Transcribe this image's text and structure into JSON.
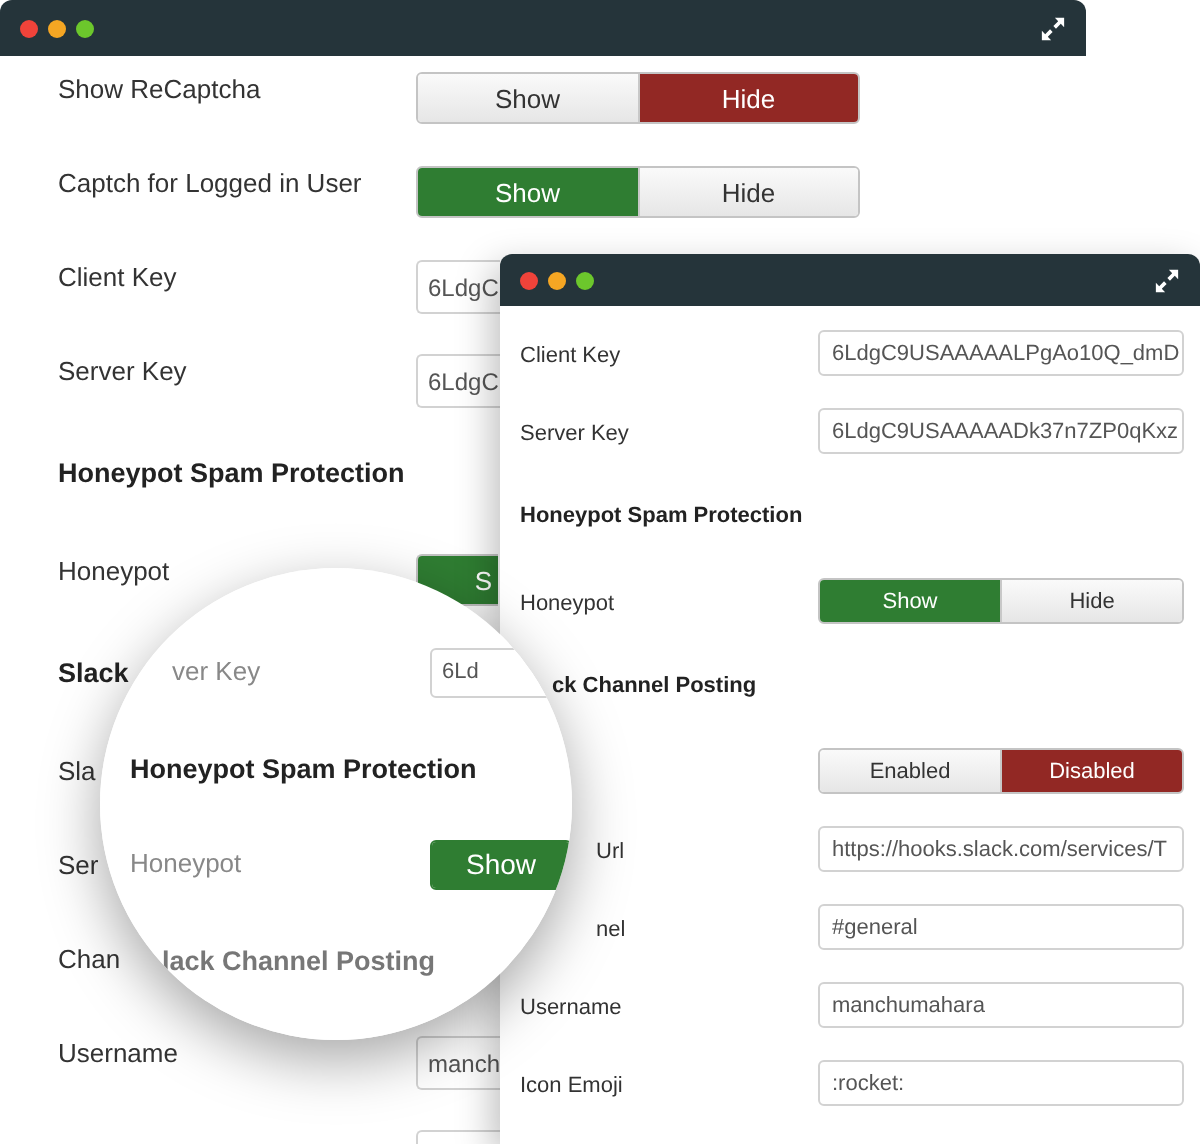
{
  "back_window": {
    "rows": [
      {
        "kind": "toggle",
        "label": "Show ReCaptcha",
        "options": [
          {
            "label": "Show",
            "selected": false
          },
          {
            "label": "Hide",
            "selected": true,
            "kind": "negative"
          }
        ]
      },
      {
        "kind": "toggle",
        "label": "Captch for Logged in User",
        "options": [
          {
            "label": "Show",
            "selected": true,
            "kind": "positive"
          },
          {
            "label": "Hide",
            "selected": false
          }
        ]
      },
      {
        "kind": "field",
        "label": "Client Key",
        "value": "6LdgC"
      },
      {
        "kind": "field",
        "label": "Server Key",
        "value": "6LdgC"
      },
      {
        "kind": "heading",
        "label": "Honeypot Spam Protection"
      },
      {
        "kind": "toggle",
        "label": "Honeypot",
        "options": [
          {
            "label": "S",
            "selected": true,
            "kind": "positive"
          }
        ]
      },
      {
        "kind": "heading",
        "label": "Slack"
      },
      {
        "kind": "label",
        "label": "Sla"
      },
      {
        "kind": "label",
        "label": "Ser"
      },
      {
        "kind": "label",
        "label": "Chan"
      },
      {
        "kind": "field",
        "label": "Username",
        "value": "manch"
      },
      {
        "kind": "field"
      }
    ]
  },
  "front_window": {
    "rows": [
      {
        "kind": "field",
        "label": "Client Key",
        "value": "6LdgC9USAAAAALPgAo10Q_dmD"
      },
      {
        "kind": "field",
        "label": "Server Key",
        "value": "6LdgC9USAAAAADk37n7ZP0qKxz"
      },
      {
        "kind": "heading",
        "label": "Honeypot Spam Protection"
      },
      {
        "kind": "toggle",
        "label": "Honeypot",
        "options": [
          {
            "label": "Show",
            "selected": true,
            "kind": "positive"
          },
          {
            "label": "Hide",
            "selected": false
          }
        ]
      },
      {
        "kind": "heading",
        "label": "ck Channel Posting",
        "covered": true
      },
      {
        "kind": "toggle",
        "options": [
          {
            "label": "Enabled",
            "selected": false
          },
          {
            "label": "Disabled",
            "selected": true,
            "kind": "negative"
          }
        ]
      },
      {
        "kind": "field",
        "label": "Url",
        "covered": true,
        "value": "https://hooks.slack.com/services/T"
      },
      {
        "kind": "field",
        "label": "nel",
        "covered": true,
        "value": "#general"
      },
      {
        "kind": "field",
        "label": "Username",
        "value": "manchumahara"
      },
      {
        "kind": "field",
        "label": "Icon Emoji",
        "value": ":rocket:"
      }
    ]
  },
  "magnifier": {
    "rows": [
      {
        "kind": "field",
        "label": "ver Key",
        "covered": true,
        "value": "6Ld"
      },
      {
        "kind": "heading",
        "label": "Honeypot Spam Protection"
      },
      {
        "kind": "toggle",
        "label": "Honeypot",
        "options": [
          {
            "label": "Show",
            "selected": true,
            "kind": "positive"
          }
        ]
      },
      {
        "kind": "heading",
        "label": "lack Channel Posting",
        "covered": true
      }
    ]
  }
}
